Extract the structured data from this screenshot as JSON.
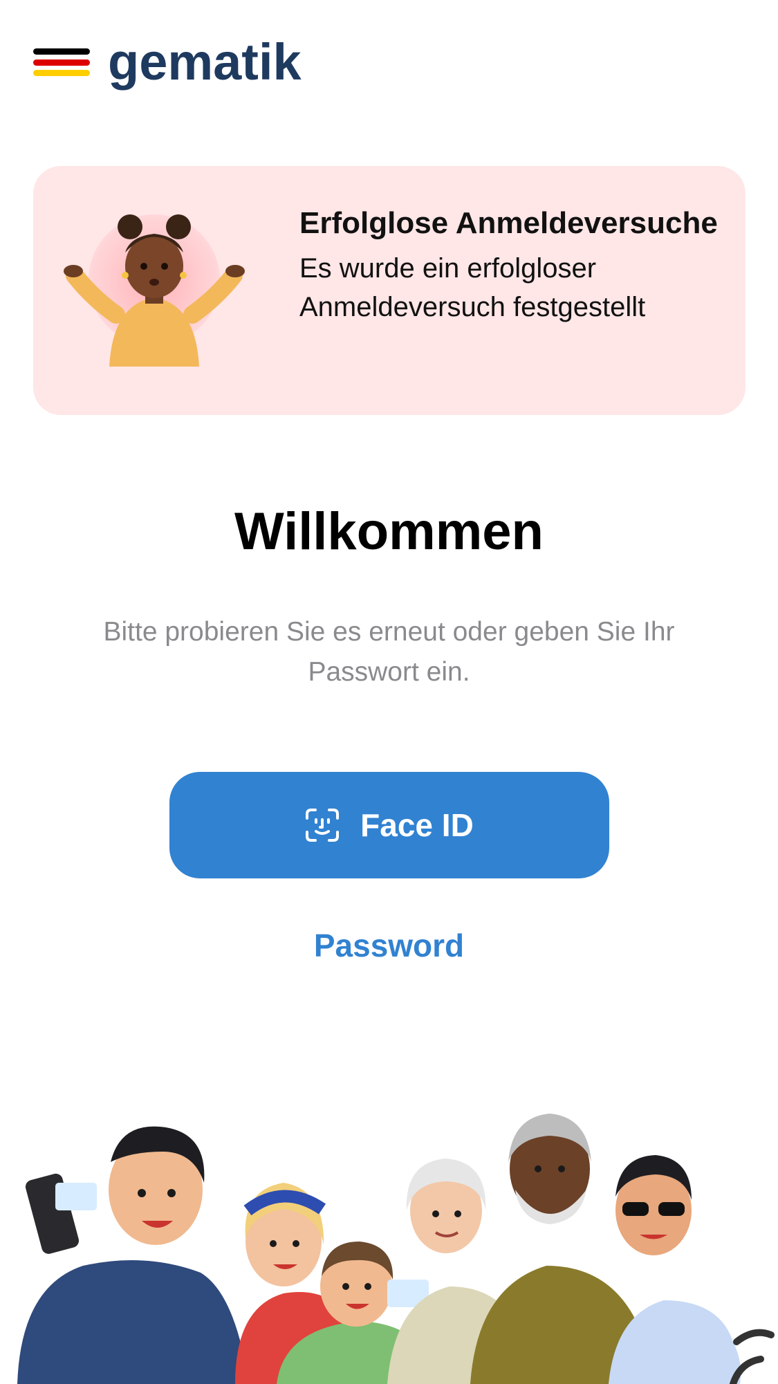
{
  "header": {
    "logo_text": "gematik",
    "flag_colors": [
      "#000000",
      "#dd0000",
      "#ffce00"
    ]
  },
  "alert": {
    "title": "Erfolglose Anmeldeversuche",
    "body": "Es wurde ein erfolgloser Anmeldeversuch festgestellt",
    "background": "#ffe6e7",
    "illustration": "shrugging-person-illustration"
  },
  "welcome": {
    "title": "Willkommen",
    "subtitle": "Bitte probieren Sie es erneut oder geben Sie Ihr Passwort ein."
  },
  "actions": {
    "faceid_label": "Face ID",
    "faceid_icon": "face-id-icon",
    "password_label": "Password",
    "accent": "#3182d1"
  },
  "footer": {
    "illustration": "group-of-people-illustration"
  }
}
